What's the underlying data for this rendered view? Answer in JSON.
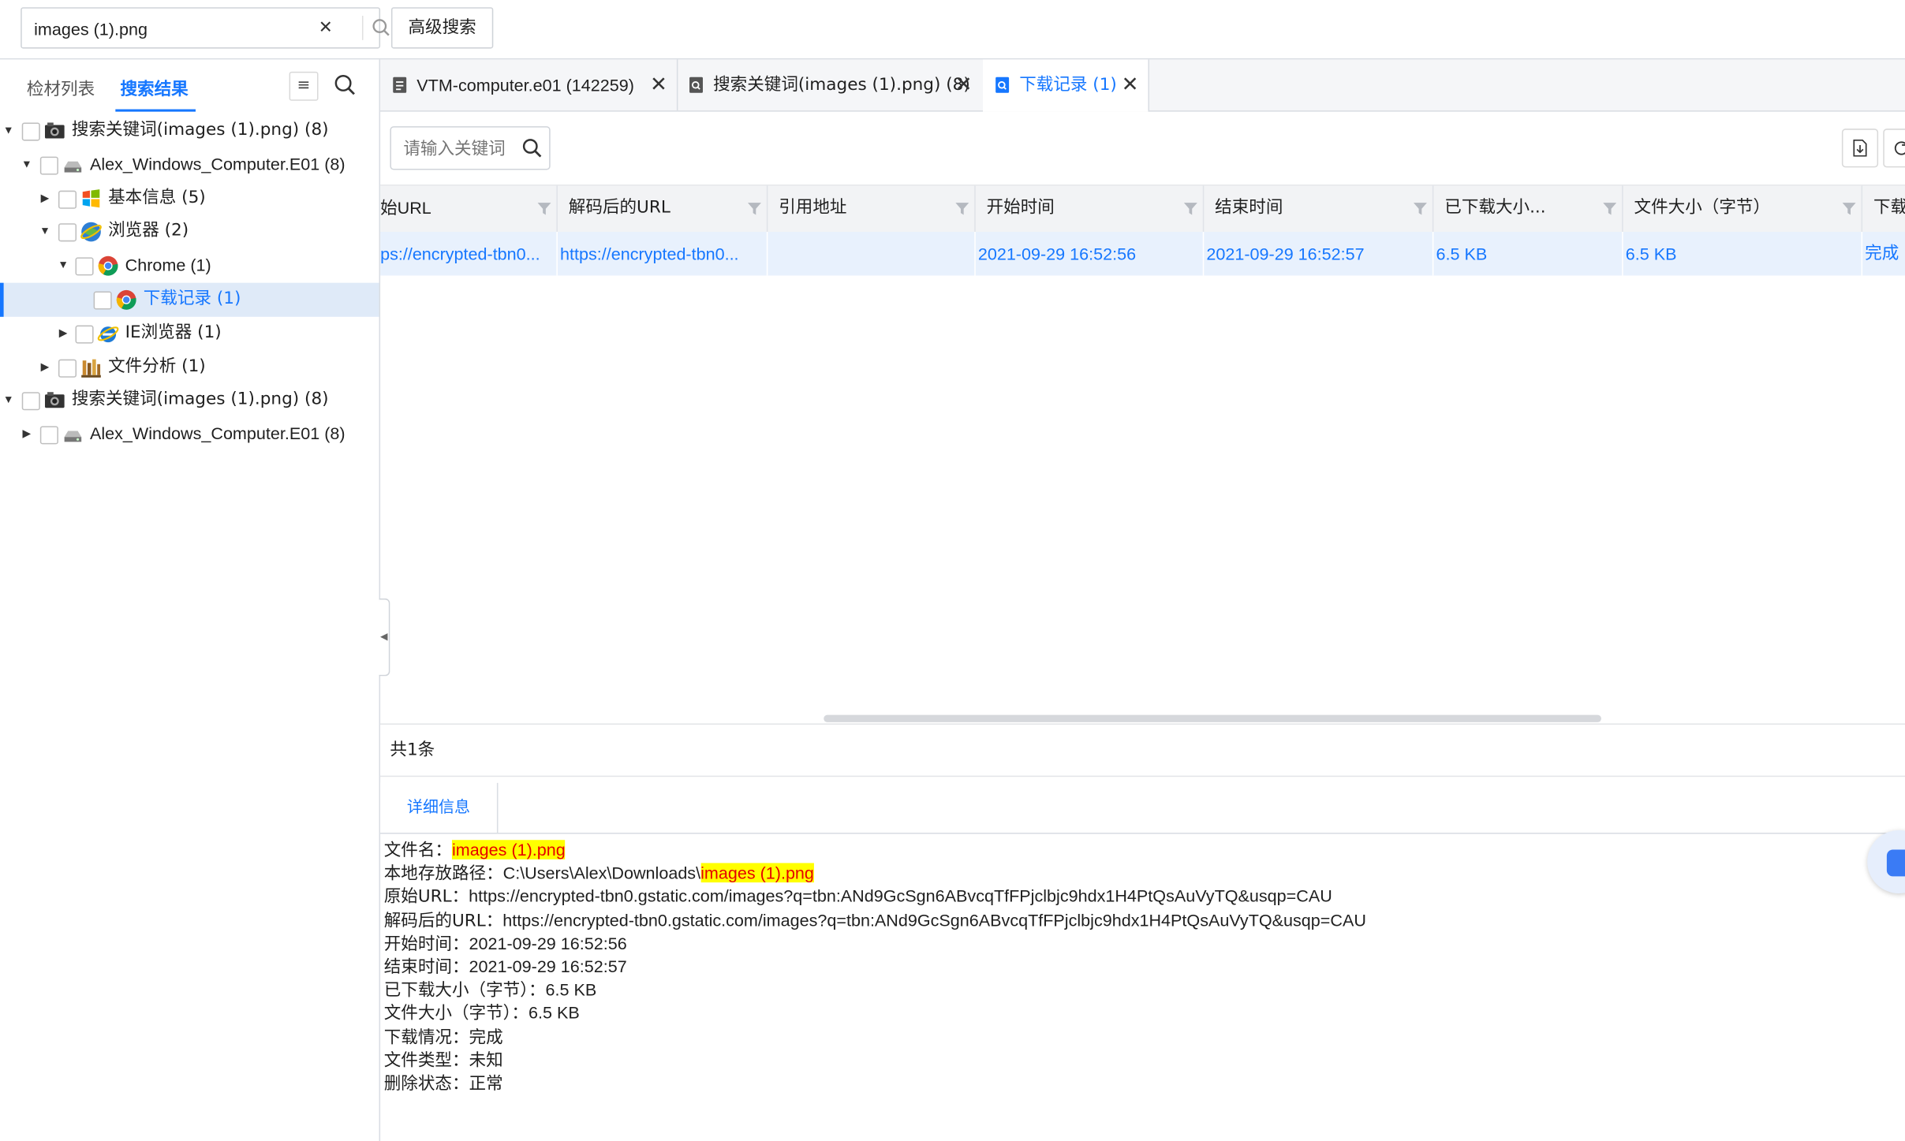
{
  "search": {
    "value": "images (1).png",
    "clear": "✕",
    "advanced_label": "高级搜索"
  },
  "sidebar": {
    "tabs": [
      "检材列表",
      "搜索结果"
    ],
    "menu_icon": "≡",
    "tree": [
      {
        "label": "搜索关键词(images (1).png) (8)",
        "icon": "camera-icon"
      },
      {
        "label": "Alex_Windows_Computer.E01 (8)",
        "icon": "disk-icon"
      },
      {
        "label": "基本信息 (5)",
        "icon": "windows-icon"
      },
      {
        "label": "浏览器 (2)",
        "icon": "browser-icon"
      },
      {
        "label": "Chrome (1)",
        "icon": "chrome-icon"
      },
      {
        "label": "下载记录 (1)",
        "icon": "chrome-icon"
      },
      {
        "label": "IE浏览器 (1)",
        "icon": "ie-icon"
      },
      {
        "label": "文件分析 (1)",
        "icon": "bookshelf-icon"
      },
      {
        "label": "搜索关键词(images (1).png) (8)",
        "icon": "camera-icon"
      },
      {
        "label": "Alex_Windows_Computer.E01 (8)",
        "icon": "disk-icon"
      }
    ]
  },
  "tabs": [
    {
      "label": "VTM-computer.e01 (142259)",
      "icon": "document-icon"
    },
    {
      "label": "搜索关键词(images (1).png) (8)",
      "icon": "search-doc-icon"
    },
    {
      "label": "下载记录 (1)",
      "icon": "search-doc-icon"
    }
  ],
  "toolbar": {
    "keyword_placeholder": "请输入关键词"
  },
  "table": {
    "columns": [
      "始URL",
      "解码后的URL",
      "引用地址",
      "开始时间",
      "结束时间",
      "已下载大小...",
      "文件大小（字节）",
      "下载"
    ],
    "rows": [
      [
        "ps://encrypted-tbn0...",
        "https://encrypted-tbn0...",
        "",
        "2021-09-29 16:52:56",
        "2021-09-29 16:52:57",
        "6.5 KB",
        "6.5 KB",
        "完成"
      ]
    ],
    "total": "共1条"
  },
  "details": {
    "tab_label": "详细信息",
    "lines": [
      {
        "key": "文件名：",
        "value": "",
        "highlight": "images (1).png"
      },
      {
        "key": "本地存放路径：",
        "value": "C:\\Users\\Alex\\Downloads\\",
        "highlight": "images (1).png"
      },
      {
        "key": "原始URL：",
        "value": "https://encrypted-tbn0.gstatic.com/images?q=tbn:ANd9GcSgn6ABvcqTfFPjclbjc9hdx1H4PtQsAuVyTQ&usqp=CAU",
        "highlight": ""
      },
      {
        "key": "解码后的URL：",
        "value": "https://encrypted-tbn0.gstatic.com/images?q=tbn:ANd9GcSgn6ABvcqTfFPjclbjc9hdx1H4PtQsAuVyTQ&usqp=CAU",
        "highlight": ""
      },
      {
        "key": "开始时间：",
        "value": "2021-09-29 16:52:56",
        "highlight": ""
      },
      {
        "key": "结束时间：",
        "value": "2021-09-29 16:52:57",
        "highlight": ""
      },
      {
        "key": "已下载大小（字节）：",
        "value": "6.5 KB",
        "highlight": ""
      },
      {
        "key": "文件大小（字节）：",
        "value": "6.5 KB",
        "highlight": ""
      },
      {
        "key": "下载情况：",
        "value": "完成",
        "highlight": ""
      },
      {
        "key": "文件类型：",
        "value": "未知",
        "highlight": ""
      },
      {
        "key": "删除状态：",
        "value": "正常",
        "highlight": ""
      }
    ]
  },
  "colors": {
    "accent": "#1677ff",
    "selection": "#e8f1fd",
    "highlight_bg": "#ffff00",
    "highlight_fg": "#e60000"
  }
}
